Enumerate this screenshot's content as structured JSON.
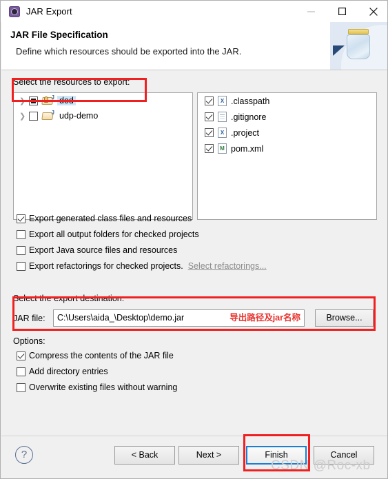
{
  "window": {
    "title": "JAR Export",
    "icon": "jar-export-gear-icon",
    "controls": {
      "minimize": "minimize-icon",
      "maximize": "maximize-icon",
      "close": "close-icon"
    }
  },
  "header": {
    "title": "JAR File Specification",
    "subtitle": "Define which resources should be exported into the JAR.",
    "art": "jar-bottle-illustration"
  },
  "resources": {
    "label": "Select the resources to export:",
    "tree": [
      {
        "label": "dod",
        "checkbox": "partial",
        "expanded": false,
        "selected": true,
        "icon": "java-project-folder-icon"
      },
      {
        "label": "udp-demo",
        "checkbox": "unchecked",
        "expanded": false,
        "selected": false,
        "icon": "project-folder-icon"
      }
    ],
    "files": [
      {
        "label": ".classpath",
        "checkbox": "checked",
        "icon": "xml-file-icon",
        "glyph": "X"
      },
      {
        "label": ".gitignore",
        "checkbox": "checked",
        "icon": "text-file-icon",
        "glyph": ""
      },
      {
        "label": ".project",
        "checkbox": "checked",
        "icon": "xml-file-icon",
        "glyph": "X"
      },
      {
        "label": "pom.xml",
        "checkbox": "checked",
        "icon": "maven-file-icon",
        "glyph": "M"
      }
    ]
  },
  "export_options": [
    {
      "label": "Export generated class files and resources",
      "checked": true
    },
    {
      "label": "Export all output folders for checked projects",
      "checked": false
    },
    {
      "label": "Export Java source files and resources",
      "checked": false
    },
    {
      "label": "Export refactorings for checked projects.",
      "checked": false,
      "link": "Select refactorings..."
    }
  ],
  "destination": {
    "label": "Select the export destination:",
    "jar_file_label": "JAR file:",
    "jar_file_value": "C:\\Users\\aida_\\Desktop\\demo.jar",
    "jar_file_placeholder": "",
    "annotation": "导出路径及jar名称",
    "browse_label": "Browse..."
  },
  "options": {
    "label": "Options:",
    "items": [
      {
        "label": "Compress the contents of the JAR file",
        "checked": true
      },
      {
        "label": "Add directory entries",
        "checked": false
      },
      {
        "label": "Overwrite existing files without warning",
        "checked": false
      }
    ]
  },
  "footer": {
    "help": "?",
    "back": "< Back",
    "next": "Next >",
    "finish": "Finish",
    "cancel": "Cancel"
  },
  "watermark": "CSDN @Roc-xb",
  "colors": {
    "annotation_red": "#f02020",
    "focus_blue": "#1a7fd4",
    "selection_blue": "#cfe5f7"
  }
}
